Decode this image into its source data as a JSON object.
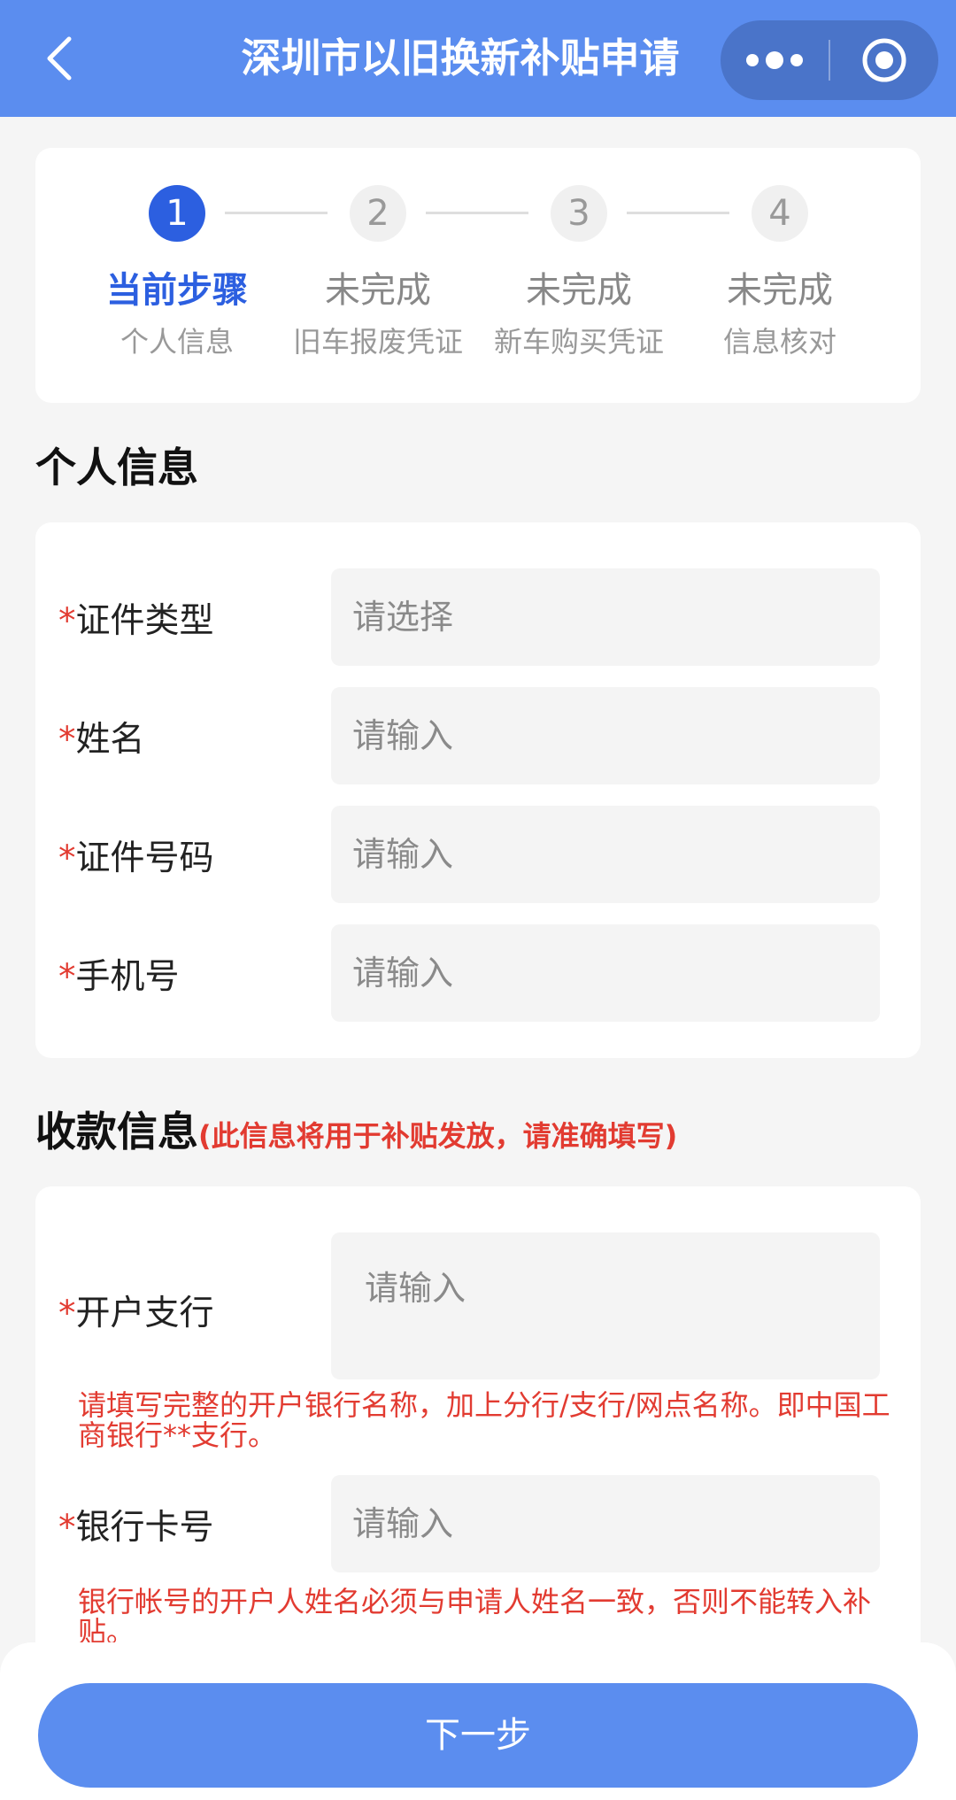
{
  "header": {
    "title": "深圳市以旧换新补贴申请"
  },
  "steps": [
    {
      "number": "1",
      "status": "当前步骤",
      "desc": "个人信息"
    },
    {
      "number": "2",
      "status": "未完成",
      "desc": "旧车报废凭证"
    },
    {
      "number": "3",
      "status": "未完成",
      "desc": "新车购买凭证"
    },
    {
      "number": "4",
      "status": "未完成",
      "desc": "信息核对"
    }
  ],
  "personal": {
    "title": "个人信息",
    "required_mark": "*",
    "fields": [
      {
        "label": "证件类型",
        "placeholder": "请选择"
      },
      {
        "label": "姓名",
        "placeholder": "请输入"
      },
      {
        "label": "证件号码",
        "placeholder": "请输入"
      },
      {
        "label": "手机号",
        "placeholder": "请输入"
      }
    ]
  },
  "payment": {
    "title": "收款信息",
    "note": "(此信息将用于补贴发放，请准确填写)",
    "fields": [
      {
        "label": "开户支行",
        "placeholder": "请输入",
        "hint": "请填写完整的开户银行名称，加上分行/支行/网点名称。即中国工商银行**支行。"
      },
      {
        "label": "银行卡号",
        "placeholder": "请输入",
        "hint": "银行帐号的开户人姓名必须与申请人姓名一致，否则不能转入补贴。"
      }
    ]
  },
  "footer": {
    "next_label": "下一步"
  },
  "colors": {
    "primary": "#5b8def",
    "active_step": "#2c5fe0",
    "required": "#e23b31"
  }
}
